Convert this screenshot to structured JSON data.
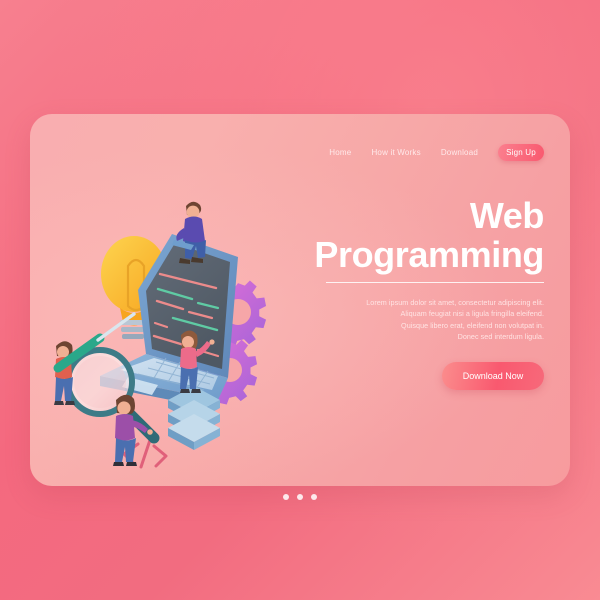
{
  "page": {
    "background_start": "#f7808f",
    "background_end": "#f98b93",
    "card_background_start": "#f9aeb0",
    "card_background_end": "#f79b9e"
  },
  "nav": {
    "items": [
      {
        "label": "Home"
      },
      {
        "label": "How it Works"
      },
      {
        "label": "Download"
      }
    ],
    "signup_label": "Sign Up",
    "signup_color": "#f9596f",
    "link_color": "#ffe9ea"
  },
  "hero": {
    "title_line1": "Web",
    "title_line2": "Programming",
    "title_color": "#ffffff",
    "body": [
      "Lorem ipsum dolor sit amet, consectetur adipiscing elit.",
      "Aliquam feugiat nisi a ligula fringilla eleifend.",
      "Quisque libero erat, eleifend non volutpat in.",
      "Donec sed interdum ligula."
    ],
    "cta_label": "Download Now",
    "cta_color": "#f9596f"
  },
  "illustration": {
    "name": "isometric-web-programming-scene",
    "elements": [
      "laptop",
      "code-screen",
      "lightbulb",
      "gears",
      "magnifying-glass",
      "database-stack",
      "code-brackets",
      "person-sitting-with-laptop",
      "person-pointing-at-screen",
      "person-with-pencil",
      "person-with-magnifier"
    ],
    "code_bracket_symbol": "</>",
    "laptop_body_color": "#7ea7cf",
    "screen_color": "#5b6470",
    "bulb_color": "#fbbd3c",
    "gear_color": "#d964c9",
    "database_color": "#78aacd"
  },
  "pagination": {
    "dots": [
      {
        "active": true
      },
      {
        "active": false
      },
      {
        "active": false
      }
    ],
    "dot_color": "#ffffff"
  }
}
